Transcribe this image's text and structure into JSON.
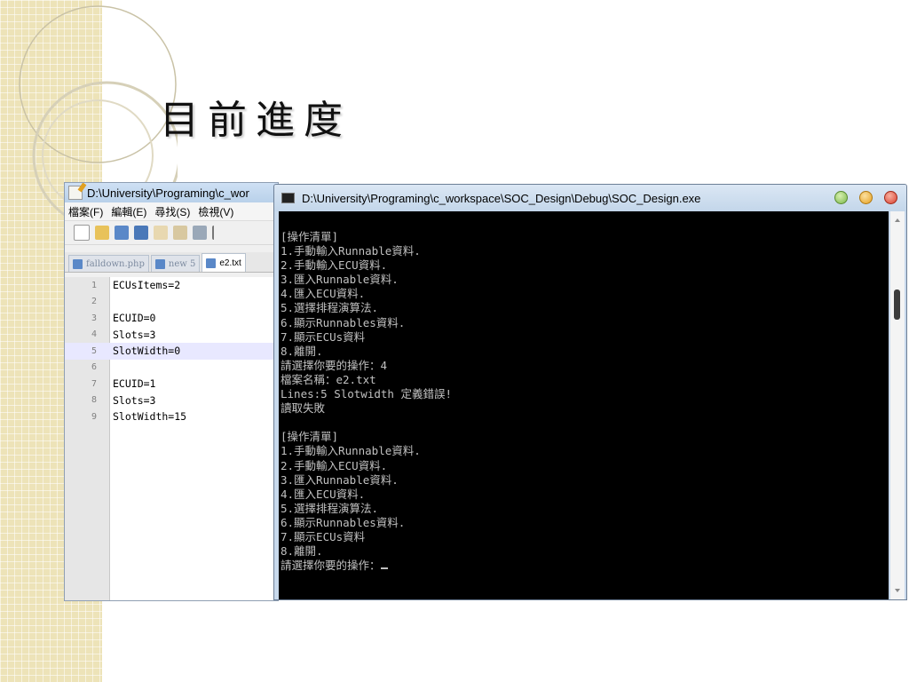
{
  "slide": {
    "title": "目前進度"
  },
  "notepad": {
    "title": "D:\\University\\Programing\\c_wor",
    "menu": [
      "檔案(F)",
      "編輯(E)",
      "尋找(S)",
      "檢視(V)"
    ],
    "tabs": [
      "falldown.php",
      "new 5",
      "e2.txt"
    ],
    "active_tab": "e2.txt",
    "lines": [
      {
        "num": "1",
        "text": "ECUsItems=2"
      },
      {
        "num": "2",
        "text": ""
      },
      {
        "num": "3",
        "text": "ECUID=0"
      },
      {
        "num": "4",
        "text": "Slots=3"
      },
      {
        "num": "5",
        "text": "SlotWidth=0"
      },
      {
        "num": "6",
        "text": ""
      },
      {
        "num": "7",
        "text": "ECUID=1"
      },
      {
        "num": "8",
        "text": "Slots=3"
      },
      {
        "num": "9",
        "text": "SlotWidth=15"
      }
    ],
    "highlighted_line": 5
  },
  "console": {
    "title": "D:\\University\\Programing\\c_workspace\\SOC_Design\\Debug\\SOC_Design.exe",
    "text": "[操作清單]\n1.手動輸入Runnable資料.\n2.手動輸入ECU資料.\n3.匯入Runnable資料.\n4.匯入ECU資料.\n5.選擇排程演算法.\n6.顯示Runnables資料.\n7.顯示ECUs資料\n8.離開.\n請選擇你要的操作：4\n檔案名稱：e2.txt\nLines:5 Slotwidth 定義錯誤!\n讀取失敗\n\n[操作清單]\n1.手動輸入Runnable資料.\n2.手動輸入ECU資料.\n3.匯入Runnable資料.\n4.匯入ECU資料.\n5.選擇排程演算法.\n6.顯示Runnables資料.\n7.顯示ECUs資料\n8.離開.\n請選擇你要的操作："
  },
  "icons": {
    "notepad_app": "notepad-plus-plus-icon",
    "console_app": "console-icon",
    "minimize": "minimize-icon",
    "maximize": "maximize-icon",
    "close": "close-icon"
  },
  "colors": {
    "console_bg": "#000000",
    "console_text": "#c0c0c0",
    "strip": "#ede3b8"
  }
}
